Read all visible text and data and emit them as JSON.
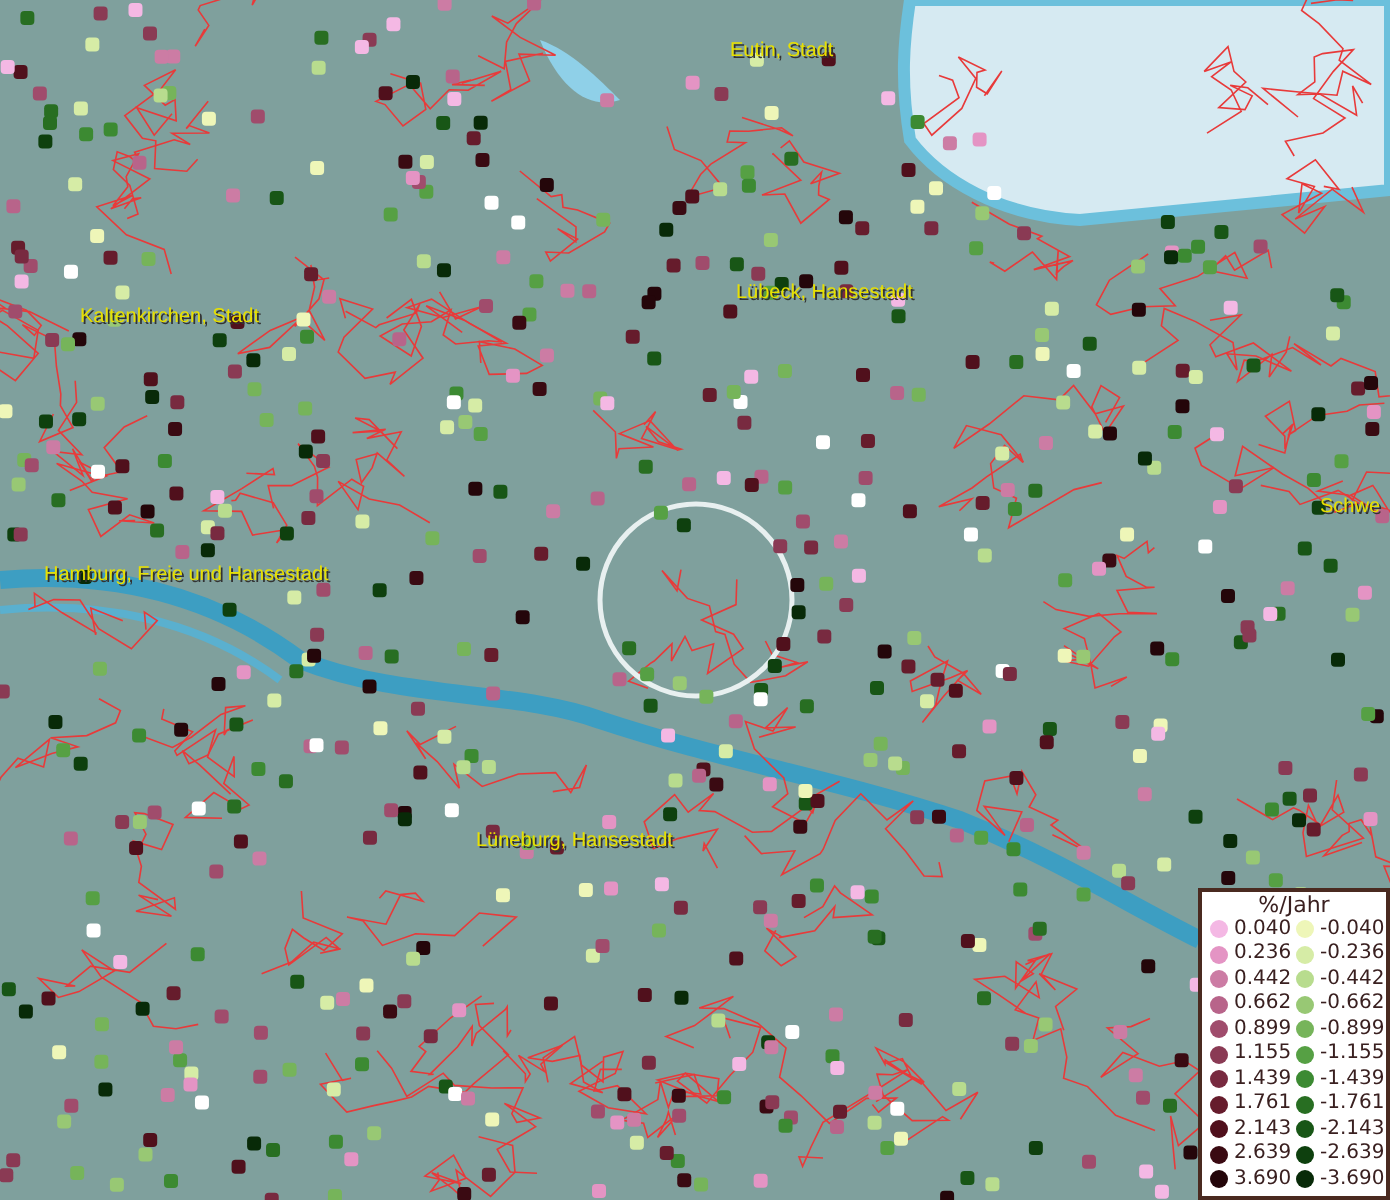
{
  "map": {
    "place_labels": [
      {
        "text": "Eutin, Stadt"
      },
      {
        "text": "Lübeck, Hansestadt"
      },
      {
        "text": "Kaltenkirchen, Stadt"
      },
      {
        "text": "Schwe"
      },
      {
        "text": "Hamburg, Freie und Hansestadt"
      },
      {
        "text": "Lüneburg, Hansestadt"
      }
    ]
  },
  "legend": {
    "title": "%/Jahr",
    "entries": [
      {
        "label": "0.040",
        "color": "#f4b8e4"
      },
      {
        "label": "-0.040",
        "color": "#eef6b8"
      },
      {
        "label": "0.236",
        "color": "#e494c4"
      },
      {
        "label": "-0.236",
        "color": "#d6eca6"
      },
      {
        "label": "0.442",
        "color": "#cc7ca4"
      },
      {
        "label": "-0.442",
        "color": "#b8dc8e"
      },
      {
        "label": "0.662",
        "color": "#b8648a"
      },
      {
        "label": "-0.662",
        "color": "#98c874"
      },
      {
        "label": "0.899",
        "color": "#a04c6c"
      },
      {
        "label": "-0.899",
        "color": "#76b45a"
      },
      {
        "label": "1.155",
        "color": "#8a3a54"
      },
      {
        "label": "-1.155",
        "color": "#56a044"
      },
      {
        "label": "1.439",
        "color": "#782a40"
      },
      {
        "label": "-1.439",
        "color": "#3c8a32"
      },
      {
        "label": "1.761",
        "color": "#661c2c"
      },
      {
        "label": "-1.761",
        "color": "#286e22"
      },
      {
        "label": "2.143",
        "color": "#50101c"
      },
      {
        "label": "-2.143",
        "color": "#185616"
      },
      {
        "label": "2.639",
        "color": "#3a0a12"
      },
      {
        "label": "-2.639",
        "color": "#0e400e"
      },
      {
        "label": "3.690",
        "color": "#24060a"
      },
      {
        "label": "-3.690",
        "color": "#082a08"
      }
    ]
  }
}
